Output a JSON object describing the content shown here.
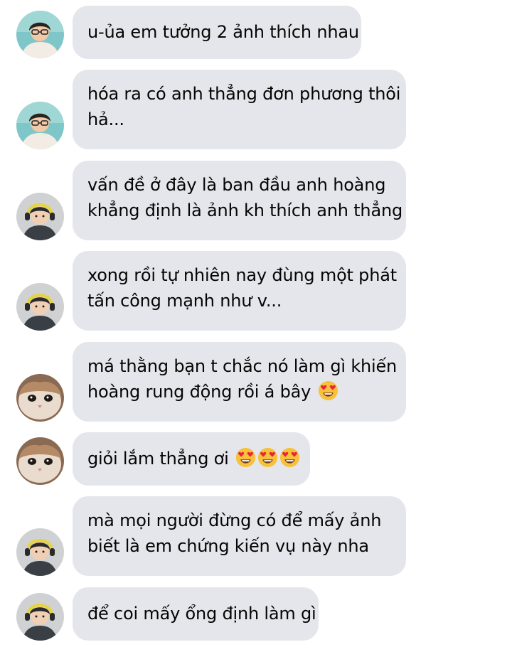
{
  "conversation": {
    "messages": [
      {
        "sender": "glasses-boy",
        "lines": [
          "u-ủa em tưởng 2 ảnh thích nhau"
        ]
      },
      {
        "sender": "glasses-boy",
        "lines": [
          "hóa ra có anh thẳng đơn phương thôi",
          "hả..."
        ]
      },
      {
        "sender": "headphone-boy",
        "lines": [
          "vấn đề ở đây là ban đầu anh hoàng",
          "khẳng định là ảnh kh thích anh thẳng"
        ]
      },
      {
        "sender": "headphone-boy",
        "lines": [
          "xong rồi tự nhiên nay đùng một phát",
          "tấn công mạnh như v..."
        ]
      },
      {
        "sender": "cat",
        "lines": [
          "má thằng bạn t chắc nó làm gì khiến",
          "hoàng rung động rồi á bây"
        ],
        "emoji": "heart-eyes",
        "emoji_count": 1
      },
      {
        "sender": "cat",
        "lines": [
          "giỏi lắm thẳng ơi"
        ],
        "emoji": "heart-eyes",
        "emoji_count": 3
      },
      {
        "sender": "headphone-boy",
        "lines": [
          "mà mọi người đừng có để mấy ảnh",
          "biết là em chứng kiến vụ này nha"
        ]
      },
      {
        "sender": "headphone-boy",
        "lines": [
          "để coi mấy ổng định làm gì"
        ]
      }
    ]
  },
  "colors": {
    "bubble_background": "#e4e6eb",
    "text": "#050505",
    "page_background": "#ffffff"
  }
}
